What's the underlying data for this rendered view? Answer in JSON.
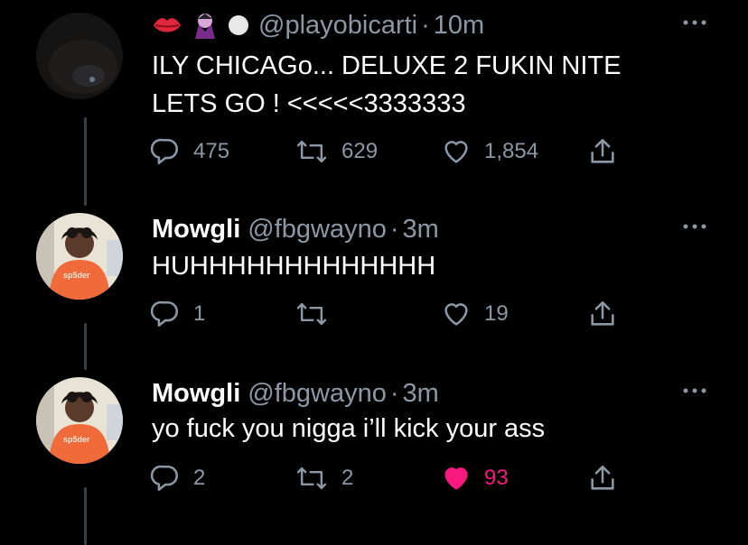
{
  "tweets": [
    {
      "name": "",
      "handle": "@playobicarti",
      "separator": "·",
      "time": "10m",
      "badges": [
        "lips-emoji",
        "vampire-emoji",
        "white-circle-emoji"
      ],
      "text": "ILY CHICAGo... DELUXE 2 FUKIN NITE\nLETS GO ! <<<<<3333333",
      "replies": "475",
      "retweets": "629",
      "likes": "1,854",
      "liked": false
    },
    {
      "name": "Mowgli",
      "handle": "@fbgwayno",
      "separator": "·",
      "time": "3m",
      "text": "HUHHHHHHHHHHHHH",
      "replies": "1",
      "retweets": "",
      "likes": "19",
      "liked": false
    },
    {
      "name": "Mowgli",
      "handle": "@fbgwayno",
      "separator": "·",
      "time": "3m",
      "text": "yo fuck you nigga i’ll kick your ass",
      "replies": "2",
      "retweets": "2",
      "likes": "93",
      "liked": true
    }
  ],
  "colors": {
    "background": "#000000",
    "secondary_text": "#8b98a5",
    "like_active": "#f91880",
    "thread_line": "#3a3f44"
  },
  "icons": [
    "reply-icon",
    "retweet-icon",
    "like-icon",
    "share-icon",
    "more-icon"
  ]
}
